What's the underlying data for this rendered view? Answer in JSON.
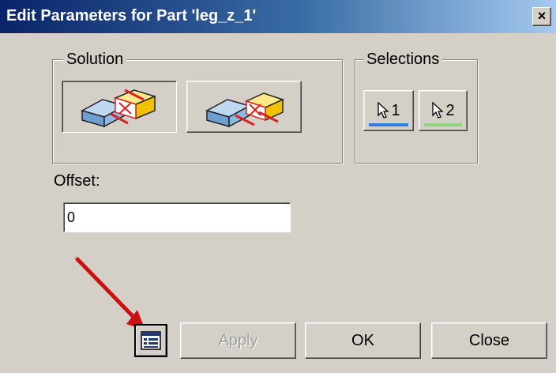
{
  "window": {
    "title": "Edit Parameters for Part 'leg_z_1'",
    "close_glyph": "×"
  },
  "solution": {
    "label": "Solution",
    "options": [
      {
        "icon": "mate-solution-1-icon",
        "selected": true
      },
      {
        "icon": "mate-solution-2-icon",
        "selected": false
      }
    ]
  },
  "selections": {
    "label": "Selections",
    "items": [
      {
        "number": "1",
        "icon": "cursor-arrow-icon",
        "color": "#2f7fe0"
      },
      {
        "number": "2",
        "icon": "cursor-arrow-icon",
        "color": "#8ed47a"
      }
    ]
  },
  "offset": {
    "label": "Offset:",
    "value": "0"
  },
  "buttons": {
    "apply": {
      "label": "Apply",
      "enabled": false
    },
    "ok": {
      "label": "OK"
    },
    "close": {
      "label": "Close"
    },
    "properties_icon": "properties-icon"
  },
  "annotation": {
    "arrow_color": "#cc1111"
  }
}
